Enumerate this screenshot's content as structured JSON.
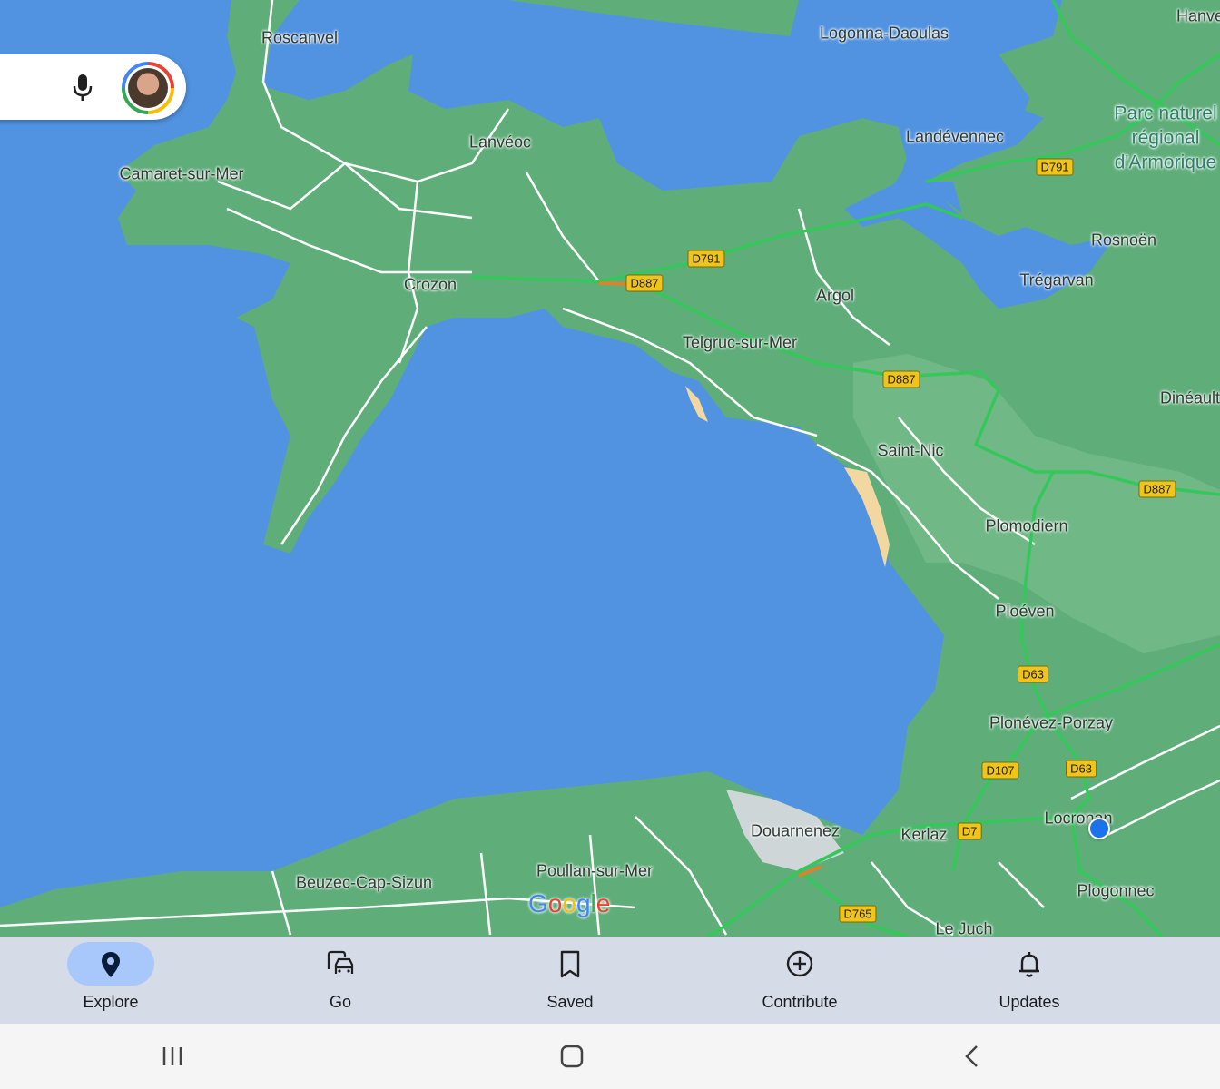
{
  "map": {
    "places": [
      {
        "id": "roscanvel",
        "label": "Roscanvel"
      },
      {
        "id": "logonna",
        "label": "Logonna-Daoulas"
      },
      {
        "id": "hanvec",
        "label": "Hanve"
      },
      {
        "id": "lanveoc",
        "label": "Lanvéoc"
      },
      {
        "id": "camaret",
        "label": "Camaret-sur-Mer"
      },
      {
        "id": "landevennec",
        "label": "Landévennec"
      },
      {
        "id": "rosnoen",
        "label": "Rosnoën"
      },
      {
        "id": "tregarvan",
        "label": "Trégarvan"
      },
      {
        "id": "crozon",
        "label": "Crozon"
      },
      {
        "id": "argol",
        "label": "Argol"
      },
      {
        "id": "telgruc",
        "label": "Telgruc-sur-Mer"
      },
      {
        "id": "dineault",
        "label": "Dinéault"
      },
      {
        "id": "saintnic",
        "label": "Saint-Nic"
      },
      {
        "id": "plomodiern",
        "label": "Plomodiern"
      },
      {
        "id": "ploeven",
        "label": "Ploéven"
      },
      {
        "id": "plonevez",
        "label": "Plonévez-Porzay"
      },
      {
        "id": "douarnenez",
        "label": "Douarnenez"
      },
      {
        "id": "kerlaz",
        "label": "Kerlaz"
      },
      {
        "id": "locronan",
        "label": "Locronan"
      },
      {
        "id": "beuzec",
        "label": "Beuzec-Cap-Sizun"
      },
      {
        "id": "poullan",
        "label": "Poullan-sur-Mer"
      },
      {
        "id": "plogonnec",
        "label": "Plogonnec"
      },
      {
        "id": "lejuch",
        "label": "Le Juch"
      }
    ],
    "park_label": [
      "Parc naturel",
      "régional",
      "d'Armorique"
    ],
    "road_shields": [
      {
        "id": "d791a",
        "label": "D791"
      },
      {
        "id": "d791b",
        "label": "D791"
      },
      {
        "id": "d887a",
        "label": "D887"
      },
      {
        "id": "d887b",
        "label": "D887"
      },
      {
        "id": "d887c",
        "label": "D887"
      },
      {
        "id": "d63a",
        "label": "D63"
      },
      {
        "id": "d63b",
        "label": "D63"
      },
      {
        "id": "d107",
        "label": "D107"
      },
      {
        "id": "d7",
        "label": "D7"
      },
      {
        "id": "d765",
        "label": "D765"
      }
    ],
    "logo_text": "Google",
    "colors": {
      "water": "#5193e1",
      "land": "#5fae7a",
      "road_major": "#34c759",
      "road_shield": "#f0c419",
      "location_dot": "#1a73e8"
    }
  },
  "bottom_nav": {
    "items": [
      {
        "label": "Explore",
        "icon": "location-pin-icon",
        "active": true
      },
      {
        "label": "Go",
        "icon": "car-commute-icon",
        "active": false
      },
      {
        "label": "Saved",
        "icon": "bookmark-icon",
        "active": false
      },
      {
        "label": "Contribute",
        "icon": "add-circle-icon",
        "active": false
      },
      {
        "label": "Updates",
        "icon": "bell-icon",
        "active": false
      }
    ]
  },
  "system_nav": {
    "recent": "recent-apps-icon",
    "home": "home-icon",
    "back": "back-icon"
  }
}
